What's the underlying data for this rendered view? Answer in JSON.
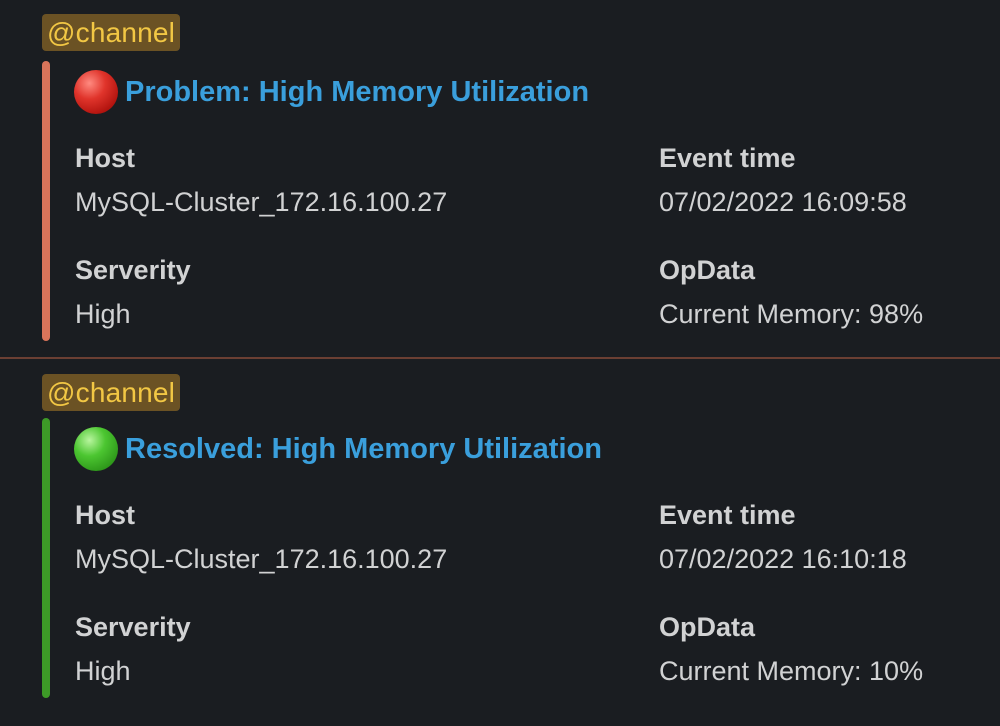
{
  "messages": [
    {
      "mention": "@channel",
      "status_icon": "red-circle-icon",
      "accent_color": "#d9745a",
      "title": "Problem: High Memory Utilization",
      "fields": {
        "host_label": "Host",
        "host_value": "MySQL-Cluster_172.16.100.27",
        "event_time_label": "Event time",
        "event_time_value": "07/02/2022 16:09:58",
        "severity_label": "Serverity",
        "severity_value": "High",
        "opdata_label": "OpData",
        "opdata_value": "Current Memory: 98%"
      }
    },
    {
      "mention": "@channel",
      "status_icon": "green-circle-icon",
      "accent_color": "#3d9a27",
      "title": "Resolved: High Memory Utilization",
      "fields": {
        "host_label": "Host",
        "host_value": "MySQL-Cluster_172.16.100.27",
        "event_time_label": "Event time",
        "event_time_value": "07/02/2022 16:10:18",
        "severity_label": "Serverity",
        "severity_value": "High",
        "opdata_label": "OpData",
        "opdata_value": "Current Memory: 10%"
      }
    }
  ],
  "colors": {
    "background": "#1a1d21",
    "link": "#3a9fdc",
    "mention_bg": "#6b5224",
    "mention_text": "#f2c744",
    "divider": "#6b3f33"
  }
}
